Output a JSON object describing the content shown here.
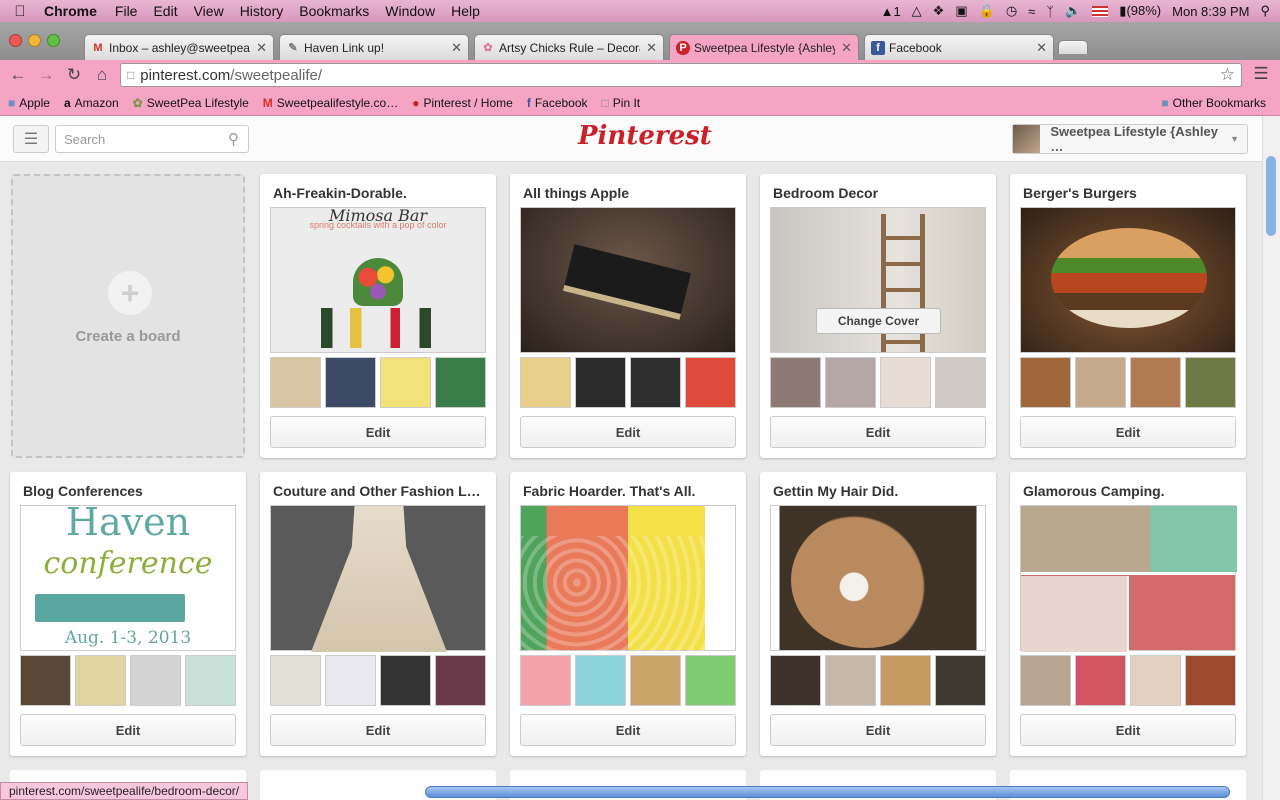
{
  "menubar": {
    "apple_icon": "apple-icon",
    "app_name": "Chrome",
    "items": [
      "File",
      "Edit",
      "View",
      "History",
      "Bookmarks",
      "Window",
      "Help"
    ],
    "status_items": {
      "adobe": "1",
      "battery": "(98%)",
      "clock": "Mon 8:39 PM"
    }
  },
  "tabs": [
    {
      "favicon": "M",
      "title": "Inbox – ashley@sweetpeal…",
      "color": "#d93025"
    },
    {
      "favicon": "✎",
      "title": "Haven Link up!",
      "color": "#777777"
    },
    {
      "favicon": "✿",
      "title": "Artsy Chicks Rule – Decora…",
      "color": "#e07aa0"
    },
    {
      "favicon": "P",
      "title": "Sweetpea Lifestyle {Ashley…",
      "color": "#cb2027",
      "active": true
    },
    {
      "favicon": "f",
      "title": "Facebook",
      "color": "#3b5998"
    }
  ],
  "address": {
    "host": "pinterest.com",
    "path": "/sweetpealife/"
  },
  "bookmarks": [
    {
      "icon": "folder-icon",
      "label": "Apple"
    },
    {
      "icon": "amazon-icon",
      "label": "Amazon"
    },
    {
      "icon": "leaf-icon",
      "label": "SweetPea Lifestyle"
    },
    {
      "icon": "gmail-icon",
      "label": "Sweetpealifestyle.co…"
    },
    {
      "icon": "pinterest-icon",
      "label": "Pinterest / Home"
    },
    {
      "icon": "facebook-icon",
      "label": "Facebook"
    },
    {
      "icon": "page-icon",
      "label": "Pin It"
    }
  ],
  "other_bookmarks": "Other Bookmarks",
  "header": {
    "search_placeholder": "Search",
    "logo": "Pinterest",
    "user_name": "Sweetpea Lifestyle {Ashley …"
  },
  "create_board": "Create a board",
  "boards": [
    {
      "title": "Ah-Freakin-Dorable.",
      "cover_text": "Mimosa Bar",
      "cover_sub": "spring cocktails with a pop of color",
      "cover_bg": "#ececec",
      "thumbs": [
        "#d9c4a3",
        "#3d4a67",
        "#f2e27a",
        "#3a7d4a"
      ]
    },
    {
      "title": "All things Apple",
      "cover_bg": "#3b2f26",
      "thumbs": [
        "#e9d08a",
        "#2a2a2a",
        "#2e2e2e",
        "#e14a3b"
      ]
    },
    {
      "title": "Bedroom Decor",
      "cover_bg": "#d8d4cd",
      "change_cover": "Change Cover",
      "thumbs": [
        "#8b7b74",
        "#b6a7a7",
        "#e7ddd5",
        "#cfc8c2"
      ]
    },
    {
      "title": "Berger's Burgers",
      "cover_bg": "#6e4a2b",
      "thumbs": [
        "#a0673a",
        "#c6a88a",
        "#b07a52",
        "#6d7a43"
      ]
    },
    {
      "title": "Blog Conferences",
      "cover_text": "Haven",
      "cover_sub": "conference",
      "cover_date": "Aug. 1-3, 2013",
      "cover_bg": "#ffffff",
      "thumbs": [
        "#5c4636",
        "#e2d3a3",
        "#d3d3d3",
        "#c8e1d8"
      ]
    },
    {
      "title": "Couture and Other Fashion L…",
      "cover_bg": "#5a5a5a",
      "thumbs": [
        "#e3e0d5",
        "#e8e8ee",
        "#333333",
        "#6a3a4a"
      ]
    },
    {
      "title": "Fabric Hoarder. That's All.",
      "cover_bg": "#f0b24a",
      "thumbs": [
        "#f2a2a8",
        "#8dd3dc",
        "#c8a36a",
        "#7fcb70"
      ]
    },
    {
      "title": "Gettin My Hair Did.",
      "cover_bg": "#9a7250",
      "thumbs": [
        "#3c3228",
        "#c5b7a9",
        "#c69a63",
        "#3f3a30"
      ]
    },
    {
      "title": "Glamorous Camping.",
      "cover_bg": "#5e8f5c",
      "thumbs": [
        "#b7a491",
        "#d25462",
        "#e3d0c0",
        "#9e4a2f"
      ]
    }
  ],
  "edit_label": "Edit",
  "status_url": "pinterest.com/sweetpealife/bedroom-decor/"
}
